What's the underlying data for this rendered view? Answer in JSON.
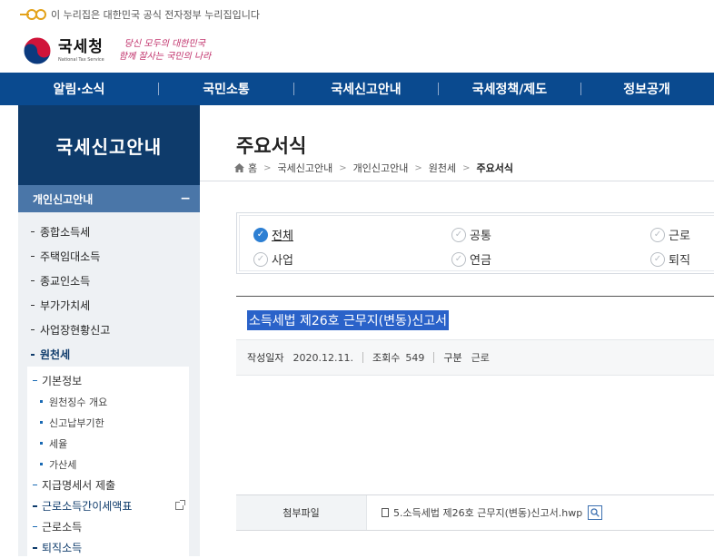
{
  "top_notice": "이 누리집은 대한민국 공식 전자정부 누리집입니다",
  "brand": {
    "name": "국세청",
    "sub": "National Tax Service",
    "slogan_line1": "당신 모두의 대한민국",
    "slogan_line2": "함께 잘사는 국민의 나라"
  },
  "gnb": [
    "알림·소식",
    "국민소통",
    "국세신고안내",
    "국세정책/제도",
    "정보공개"
  ],
  "lnb": {
    "title": "국세신고안내",
    "section": "개인신고안내",
    "section_toggle": "−",
    "items": [
      "종합소득세",
      "주택임대소득",
      "종교인소득",
      "부가가치세",
      "사업장현황신고",
      "원천세"
    ],
    "sub": [
      {
        "label": "기본정보",
        "children": [
          "원천징수 개요",
          "신고납부기한",
          "세율",
          "가산세"
        ]
      },
      {
        "label": "지급명세서 제출"
      },
      {
        "label": "근로소득간이세액표"
      },
      {
        "label": "근로소득"
      },
      {
        "label": "퇴직소득"
      }
    ]
  },
  "page": {
    "title": "주요서식",
    "breadcrumb": [
      "홈",
      "국세신고안내",
      "개인신고안내",
      "원천세",
      "주요서식"
    ]
  },
  "filters": [
    {
      "label": "전체",
      "checked": true
    },
    {
      "label": "공통",
      "checked": false
    },
    {
      "label": "근로",
      "checked": false
    },
    {
      "label": "사업",
      "checked": false
    },
    {
      "label": "연금",
      "checked": false
    },
    {
      "label": "퇴직",
      "checked": false
    }
  ],
  "document": {
    "title": "소득세법 제26호 근무지(변동)신고서",
    "meta": {
      "date_label": "작성일자",
      "date": "2020.12.11.",
      "views_label": "조회수",
      "views": "549",
      "category_label": "구분",
      "category": "근로"
    },
    "attachment_label": "첨부파일",
    "attachment_file": "5.소득세법 제26호 근무지(변동)신고서.hwp"
  },
  "colors": {
    "navy": "#0e3b6b",
    "gnb": "#0a4a8f",
    "accent": "#2d7fd3",
    "section": "#4a76a8"
  }
}
